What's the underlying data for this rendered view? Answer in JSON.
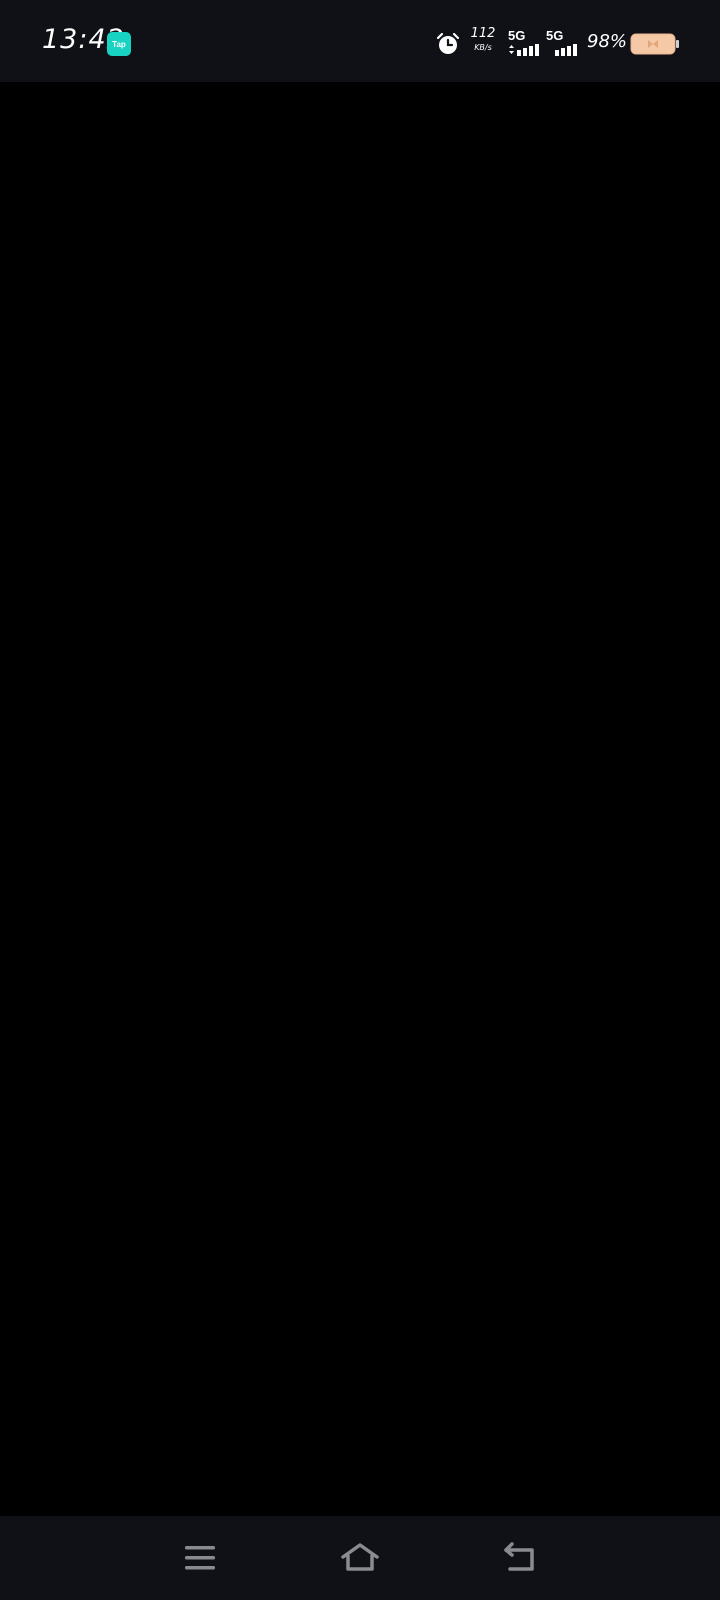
{
  "status_bar": {
    "time": "13:42",
    "app_icon_label": "Tap",
    "app_icon_color": "#18d2c2",
    "net_speed_value": "112",
    "net_speed_unit": "KB/s",
    "sim1_label": "5G",
    "sim2_label": "5G",
    "battery_percent": "98%",
    "battery_color": "#f5c9a6",
    "icons": [
      "alarm-icon",
      "signal-icon",
      "battery-icon"
    ]
  },
  "nav_bar": {
    "icons": [
      "menu-icon",
      "home-icon",
      "back-icon"
    ],
    "icon_color": "#8a8b90"
  },
  "colors": {
    "background": "#000000",
    "bar_background": "#101116"
  }
}
